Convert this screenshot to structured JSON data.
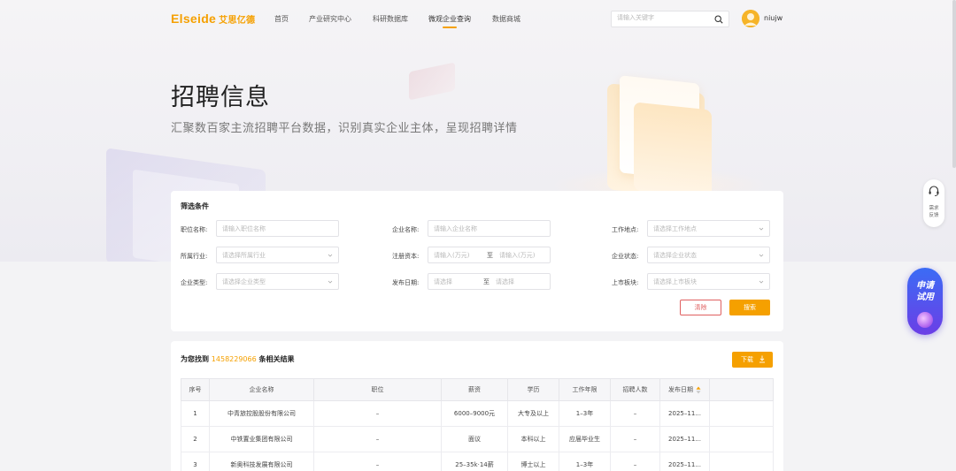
{
  "brand": {
    "logo_en": "Elseide",
    "logo_cn": "艾思亿德"
  },
  "nav": {
    "items": [
      "首页",
      "产业研究中心",
      "科研数据库",
      "微观企业查询",
      "数据商城"
    ],
    "active_index": 3
  },
  "search": {
    "placeholder": "请输入关键字",
    "value": ""
  },
  "user": {
    "name": "niujw"
  },
  "hero": {
    "title": "招聘信息",
    "subtitle": "汇聚数百家主流招聘平台数据，识别真实企业主体，呈现招聘详情"
  },
  "filters": {
    "title": "筛选条件",
    "job_name": {
      "label": "职位名称:",
      "placeholder": "请输入职位名称"
    },
    "company_name": {
      "label": "企业名称:",
      "placeholder": "请输入企业名称"
    },
    "work_location": {
      "label": "工作地点:",
      "placeholder": "请选择工作地点"
    },
    "industry": {
      "label": "所属行业:",
      "placeholder": "请选择所属行业"
    },
    "registered_capital": {
      "label": "注册资本:",
      "from_placeholder": "请输入(万元)",
      "separator": "至",
      "to_placeholder": "请输入(万元)"
    },
    "company_status": {
      "label": "企业状态:",
      "placeholder": "请选择企业状态"
    },
    "company_type": {
      "label": "企业类型:",
      "placeholder": "请选择企业类型"
    },
    "publish_date": {
      "label": "发布日期:",
      "from_placeholder": "请选择",
      "separator": "至",
      "to_placeholder": "请选择"
    },
    "listing_board": {
      "label": "上市板块:",
      "placeholder": "请选择上市板块"
    },
    "clear_label": "清除",
    "search_label": "搜索"
  },
  "results": {
    "prefix": "为您找到",
    "count": "1458229066",
    "suffix": "条相关结果",
    "download_label": "下载",
    "columns": [
      "序号",
      "企业名称",
      "职位",
      "薪资",
      "学历",
      "工作年限",
      "招聘人数",
      "发布日期"
    ],
    "rows": [
      {
        "no": "1",
        "company": "中青旅控股股份有限公司",
        "position": "–",
        "salary": "6000–9000元",
        "education": "大专及以上",
        "experience": "1–3年",
        "headcount": "–",
        "date": "2025–11..."
      },
      {
        "no": "2",
        "company": "中铁置业集团有限公司",
        "position": "–",
        "salary": "面议",
        "education": "本科以上",
        "experience": "应届毕业生",
        "headcount": "–",
        "date": "2025–11..."
      },
      {
        "no": "3",
        "company": "新奥科技发展有限公司",
        "position": "–",
        "salary": "25–35k·14薪",
        "education": "博士以上",
        "experience": "1–3年",
        "headcount": "–",
        "date": "2025–11..."
      }
    ]
  },
  "side": {
    "feedback_line1": "需求",
    "feedback_line2": "反馈",
    "trial_line1": "申请",
    "trial_line2": "试用"
  },
  "colors": {
    "accent": "#f5a000",
    "clear": "#e06060",
    "trial_gradient_top": "#3b6cf5",
    "trial_gradient_bottom": "#6b3ee6"
  }
}
